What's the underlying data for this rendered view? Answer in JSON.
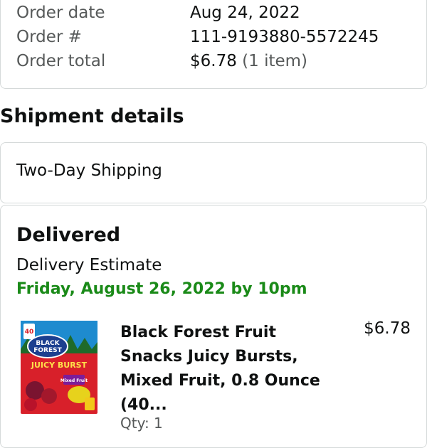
{
  "order": {
    "date_label": "Order date",
    "date_value": "Aug 24, 2022",
    "number_label": "Order #",
    "number_value": "111-9193880-5572245",
    "total_label": "Order total",
    "total_value": "$6.78",
    "total_items": "(1 item)"
  },
  "shipment": {
    "heading": "Shipment details",
    "method": "Two-Day Shipping"
  },
  "delivery": {
    "status": "Delivered",
    "estimate_label": "Delivery Estimate",
    "estimate_date": "Friday, August 26, 2022 by 10pm",
    "estimate_color": "#1a8a18"
  },
  "item": {
    "title": "Black Forest Fruit Snacks Juicy Bursts, Mixed Fruit, 0.8 Ounce (40...",
    "price": "$6.78",
    "qty": "Qty: 1",
    "image": {
      "brand_line1": "BLACK",
      "brand_line2": "FOREST",
      "product": "JUICY BURST",
      "flavor": "Mixed Fruit",
      "count": "40"
    }
  }
}
